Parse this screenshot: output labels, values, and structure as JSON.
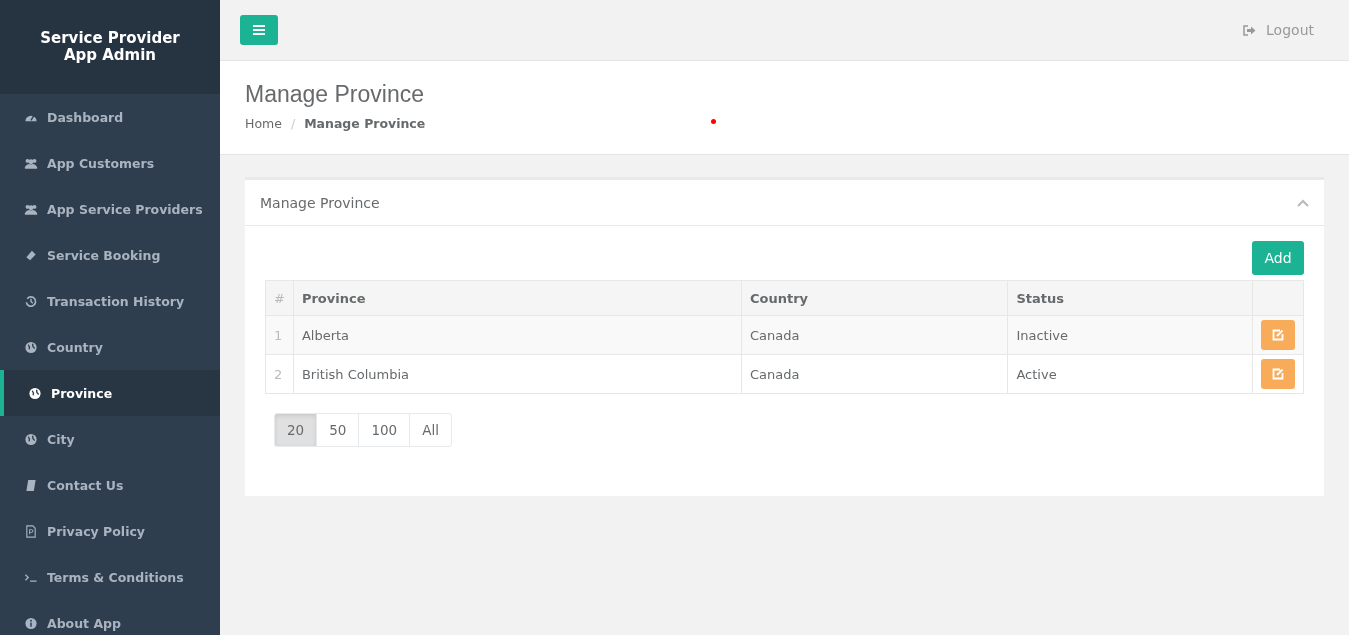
{
  "sidebar": {
    "title": "Service Provider App Admin",
    "items": [
      {
        "label": "Dashboard",
        "selected": false
      },
      {
        "label": "App Customers",
        "selected": false
      },
      {
        "label": "App Service Providers",
        "selected": false
      },
      {
        "label": "Service Booking",
        "selected": false
      },
      {
        "label": "Transaction History",
        "selected": false
      },
      {
        "label": "Country",
        "selected": false
      },
      {
        "label": "Province",
        "selected": true
      },
      {
        "label": "City",
        "selected": false
      },
      {
        "label": "Contact Us",
        "selected": false
      },
      {
        "label": "Privacy Policy",
        "selected": false
      },
      {
        "label": "Terms & Conditions",
        "selected": false
      },
      {
        "label": "About App",
        "selected": false
      }
    ]
  },
  "topbar": {
    "logout": "Logout"
  },
  "page_header": {
    "title": "Manage Province",
    "breadcrumb": [
      {
        "label": "Home"
      },
      {
        "label": "Manage Province"
      }
    ],
    "separator": "/"
  },
  "panel": {
    "title": "Manage Province",
    "add_button": "Add",
    "table": {
      "columns": [
        "#",
        "Province",
        "Country",
        "Status"
      ],
      "rows": [
        {
          "index": "1",
          "province": "Alberta",
          "country": "Canada",
          "status": "Inactive"
        },
        {
          "index": "2",
          "province": "British Columbia",
          "country": "Canada",
          "status": "Active"
        }
      ]
    },
    "page_sizes": [
      {
        "label": "20",
        "selected": true
      },
      {
        "label": "50",
        "selected": false
      },
      {
        "label": "100",
        "selected": false
      },
      {
        "label": "All",
        "selected": false
      }
    ]
  }
}
